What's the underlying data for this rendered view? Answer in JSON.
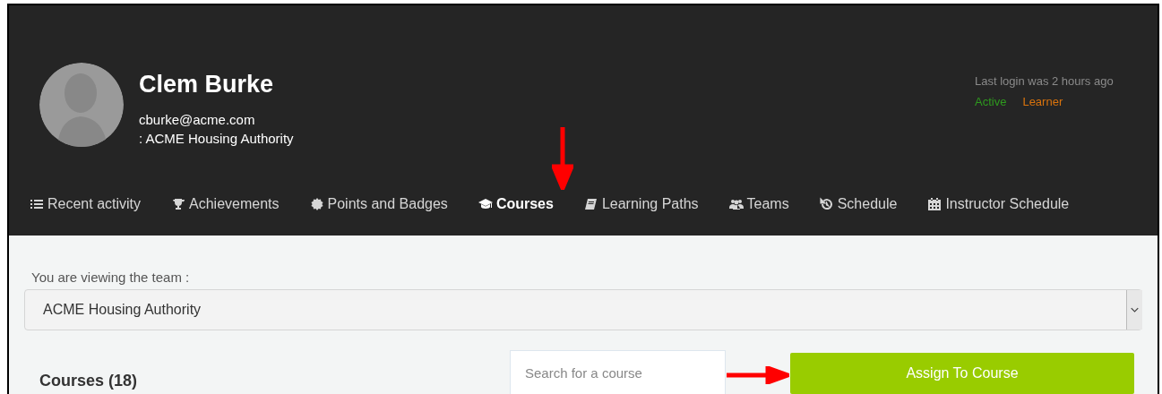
{
  "profile": {
    "name": "Clem Burke",
    "email": "cburke@acme.com",
    "organization": ": ACME Housing Authority",
    "last_login": "Last login was 2 hours ago",
    "tags": [
      {
        "label": "Active",
        "color": "#2e9a1e"
      },
      {
        "label": "Learner",
        "color": "#d9730d"
      }
    ]
  },
  "tabs": [
    {
      "label": "Recent activity",
      "selected": false
    },
    {
      "label": "Achievements",
      "selected": false
    },
    {
      "label": "Points and Badges",
      "selected": false
    },
    {
      "label": "Courses",
      "selected": true
    },
    {
      "label": "Learning Paths",
      "selected": false
    },
    {
      "label": "Teams",
      "selected": false
    },
    {
      "label": "Schedule",
      "selected": false
    },
    {
      "label": "Instructor Schedule",
      "selected": false
    }
  ],
  "team": {
    "label": "You are viewing the team :",
    "value": "ACME Housing Authority"
  },
  "courses": {
    "title": "Courses (18)",
    "search": {
      "placeholder": "Search for a course"
    },
    "assign_button": "Assign To Course"
  }
}
